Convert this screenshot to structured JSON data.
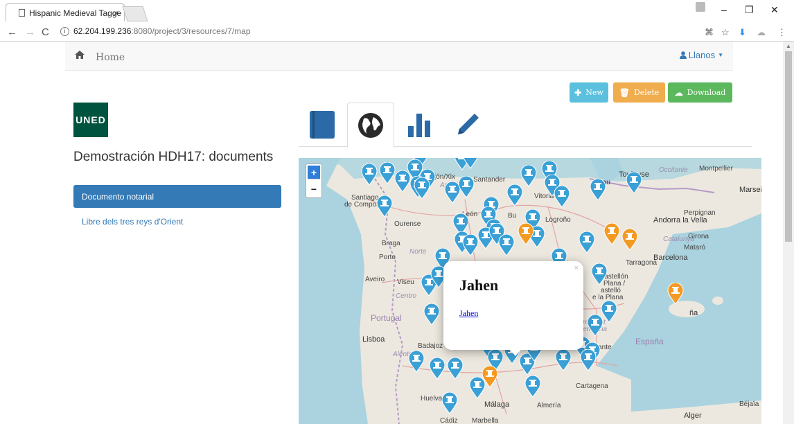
{
  "browser": {
    "tab_title": "Hispanic Medieval Tagge",
    "tab_close": "×",
    "url_host": "62.204.199.236",
    "url_path": ":8080/project/3/resources/7/map"
  },
  "navbar": {
    "home_label": "Home",
    "user_label": "Llanos"
  },
  "actions": {
    "new_label": "New",
    "delete_label": "Delete",
    "download_label": "Download"
  },
  "sidebar": {
    "logo_text": "UNED",
    "project_title": "Demostración HDH17: documents",
    "items": [
      {
        "label": "Documento notarial",
        "selected": true
      },
      {
        "label": "Libre dels tres reys d'Orient",
        "selected": false
      }
    ]
  },
  "tabs": [
    {
      "icon": "book-icon",
      "active": false
    },
    {
      "icon": "globe-icon",
      "active": true
    },
    {
      "icon": "bar-chart-icon",
      "active": false
    },
    {
      "icon": "pencil-icon",
      "active": false
    }
  ],
  "map": {
    "zoom_in": "+",
    "zoom_out": "−",
    "popup": {
      "title": "Jahen",
      "link": "Jahen",
      "close": "×"
    },
    "labels": {
      "toulouse": "Toulouse",
      "occitanie": "Occitanie",
      "montpellier": "Montpellier",
      "marseille": "Marsei",
      "santiago": "Santiago",
      "decompostela": "de Compostela",
      "gijon": "Gijón/Xix",
      "santander": "Santander",
      "asturias": "Asturias",
      "pau": "Pau",
      "andorra": "Andorra la Vella",
      "perpignan": "Perpignan",
      "catalunya": "Catalunya",
      "girona": "Girona",
      "mataro": "Mataró",
      "barcelona": "Barcelona",
      "tarragona": "Tarragona",
      "ourense": "Ourense",
      "leon": "León",
      "braga": "Braga",
      "norte": "Norte",
      "porto": "Porto",
      "aveiro": "Aveiro",
      "viseu": "Viseu",
      "centro": "Centro",
      "castellon": "Castellón",
      "plana": "Plana /",
      "stello": "astelló",
      "laplana": "e la Plana",
      "portugal": "Portugal",
      "lisboa": "Lisboa",
      "badajoz": "Badajoz",
      "alentejo": "Alentejo",
      "espana": "España",
      "malaga": "Málaga",
      "almeria": "Almería",
      "cartagena": "Cartagena",
      "huelva": "Huelva",
      "cadiz": "Cádiz",
      "marbella": "Marbella",
      "bejaia": "Béjaïa",
      "alger": "Alger",
      "logrono": "Logroño",
      "burgos": "Bu",
      "vitoria": "Vitoria-G",
      "palma": "ña",
      "comunitat": "munitat",
      "valenciana": "enciana",
      "alicante": "Alicante",
      "nt": "cant"
    },
    "markers": {
      "blue_color": "#3aa0d6",
      "orange_color": "#f39a23"
    }
  }
}
